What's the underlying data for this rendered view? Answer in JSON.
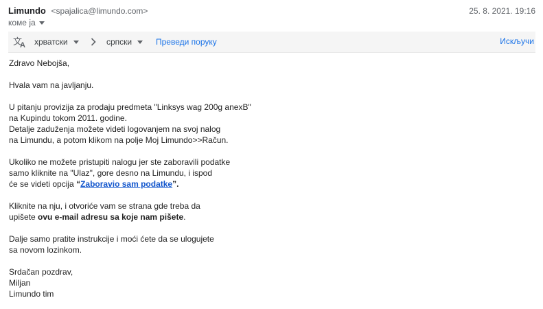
{
  "header": {
    "sender_name": "Limundo",
    "sender_email": "<spajalica@limundo.com>",
    "date": "25. 8. 2021. 19:16",
    "to_label": "коме ја"
  },
  "translate_bar": {
    "from_lang": "хрватски",
    "to_lang": "српски",
    "translate_label": "Преведи поруку",
    "turn_off_label": "Искључи"
  },
  "body": {
    "greeting": "Zdravo Nebojša,",
    "thanks": "Hvala vam na javljanju.",
    "p1": [
      "U pitanju provizija za prodaju predmeta \"Linksys wag 200g anexB\"",
      "na Kupindu tokom 2011. godine.",
      "Detalje zaduženja možete videti logovanjem na svoj nalog",
      "na Limundu, a potom klikom na polje Moj Limundo>>Račun."
    ],
    "p2": [
      "Ukoliko ne možete pristupiti nalogu jer ste zaboravili podatke",
      "samo kliknite na \"Ulaz\", gore desno na Limundu, i ispod"
    ],
    "p2_line3_prefix": "će se videti opcija ",
    "p2_open_quote": "“",
    "p2_link": "Zaboravio sam podatke",
    "p2_close_quote": "”.",
    "p3_line1": "Kliknite na nju, i otvoriće vam se strana gde treba da",
    "p3_line2_prefix": "upišete ",
    "p3_line2_bold": "ovu e-mail adresu sa koje nam pišete",
    "p3_line2_suffix": ".",
    "p4": [
      "Dalje samo pratite instrukcije i moći ćete da se ulogujete",
      "sa novom lozinkom."
    ],
    "signature": [
      "Srdačan pozdrav,",
      "Miljan",
      "Limundo tim"
    ]
  },
  "icons": {
    "translate": "translate-icon",
    "arrow": "chevron-right-icon",
    "dropdown": "caret-down-icon"
  },
  "colors": {
    "link": "#1a73e8",
    "body_link": "#1155cc",
    "bar_bg": "#f5f5f5"
  }
}
